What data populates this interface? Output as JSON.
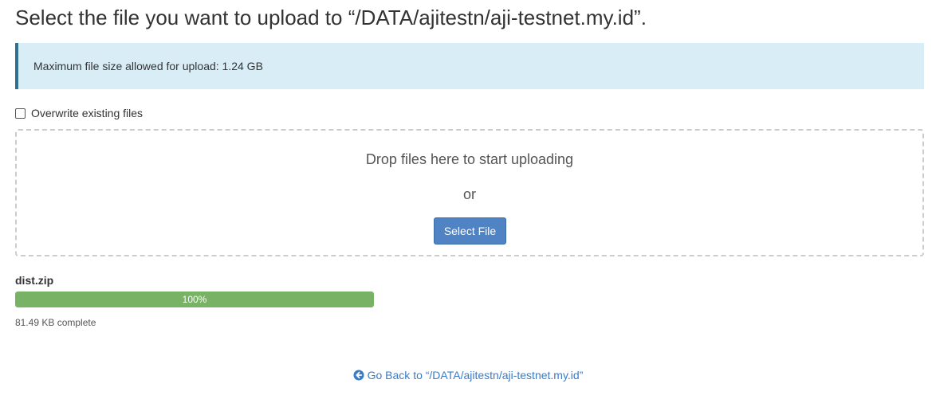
{
  "page": {
    "title": "Select the file you want to upload to “/DATA/ajitestn/aji-testnet.my.id”."
  },
  "alert": {
    "text": "Maximum file size allowed for upload: 1.24 GB"
  },
  "overwrite": {
    "label": "Overwrite existing files",
    "checked": false
  },
  "dropzone": {
    "drop_text": "Drop files here to start uploading",
    "or_text": "or",
    "select_button_label": "Select File"
  },
  "upload": {
    "file_name": "dist.zip",
    "progress_label": "100%",
    "progress_fraction": 1.0,
    "status": "81.49 KB complete"
  },
  "footer": {
    "go_back_label": "Go Back to “/DATA/ajitestn/aji-testnet.my.id”",
    "go_back_icon": "circle-arrow-left-icon"
  },
  "colors": {
    "alert_background": "#d9edf7",
    "alert_border": "#31708f",
    "button_primary": "#4f83c3",
    "progress_success": "#78b264",
    "link": "#3a7bc8"
  }
}
